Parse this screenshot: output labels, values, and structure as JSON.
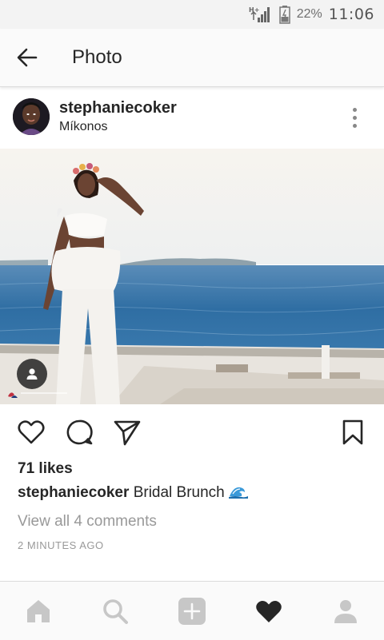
{
  "status_bar": {
    "network_label": "H+",
    "battery_percent": "22%",
    "time": "11:06"
  },
  "header": {
    "title": "Photo",
    "back_icon": "arrow-left-icon"
  },
  "post": {
    "username": "stephaniecoker",
    "location": "Míkonos",
    "likes": "71 likes",
    "caption_user": "stephaniecoker",
    "caption_text": "Bridal Brunch",
    "caption_emoji": "wave-emoji",
    "view_comments": "View all 4 comments",
    "timestamp": "2 MINUTES AGO"
  },
  "actions": [
    "heart-icon",
    "comment-icon",
    "send-icon",
    "bookmark-icon"
  ],
  "bottom_nav": {
    "items": [
      "home-icon",
      "search-icon",
      "add-icon",
      "activity-heart-icon",
      "profile-icon"
    ],
    "active": "activity-heart-icon"
  },
  "colors": {
    "text": "#262626",
    "muted": "#999999",
    "nav_inactive": "#c7c7c7",
    "sea": "#2f6ea3"
  }
}
